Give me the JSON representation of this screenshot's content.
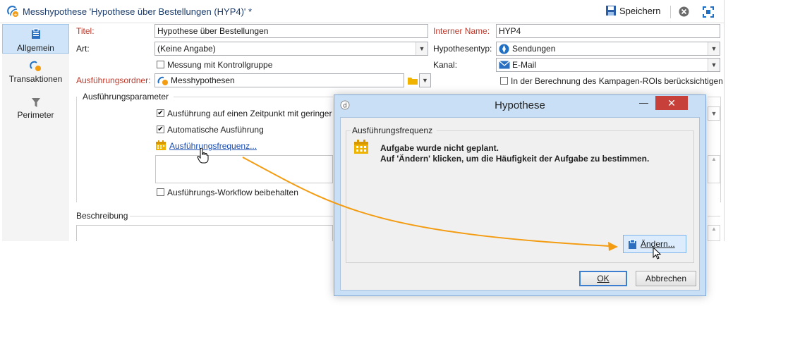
{
  "window": {
    "title": "Messhypothese 'Hypothese über Bestellungen (HYP4)' *",
    "save_label": "Speichern"
  },
  "sidebar": {
    "items": [
      {
        "label": "Allgemein",
        "icon": "clipboard-icon"
      },
      {
        "label": "Transaktionen",
        "icon": "transactions-icon"
      },
      {
        "label": "Perimeter",
        "icon": "filter-icon"
      }
    ]
  },
  "form": {
    "titel_label": "Titel:",
    "titel_value": "Hypothese über Bestellungen",
    "interner_name_label": "Interner Name:",
    "interner_name_value": "HYP4",
    "art_label": "Art:",
    "art_value": "(Keine Angabe)",
    "hypothesentyp_label": "Hypothesentyp:",
    "hypothesentyp_value": "Sendungen",
    "kontrollgruppe_label": "Messung mit Kontrollgruppe",
    "kanal_label": "Kanal:",
    "kanal_value": "E-Mail",
    "ordner_label": "Ausführungsordner:",
    "ordner_value": "Messhypothesen",
    "roi_label": "In der Berechnung des Kampagen-ROIs berücksichtigen"
  },
  "params": {
    "group_label": "Ausführungsparameter",
    "zeitpunkt_label": "Ausführung auf einen Zeitpunkt mit geringer",
    "auto_label": "Automatische Ausführung",
    "frequenz_link": "Ausführungsfrequenz...",
    "workflow_label": "Ausführungs-Workflow beibehalten"
  },
  "beschreibung": {
    "label": "Beschreibung"
  },
  "dialog": {
    "title": "Hypothese",
    "group_label": "Ausführungsfrequenz",
    "message_line1": "Aufgabe wurde nicht geplant.",
    "message_line2": "Auf 'Ändern' klicken, um die Häufigkeit der Aufgabe zu bestimmen.",
    "change_button": "Ändern...",
    "ok_button": "OK",
    "cancel_button": "Abbrechen"
  },
  "colors": {
    "accent": "#f39c12",
    "required_label": "#c0392b",
    "link": "#1a4db3"
  }
}
